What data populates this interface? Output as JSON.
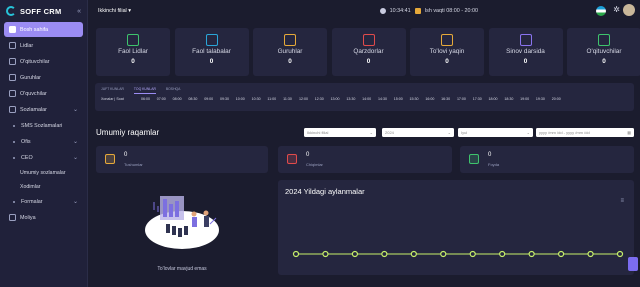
{
  "app": {
    "name": "SOFF CRM"
  },
  "sidebar": {
    "items": [
      {
        "label": "Bosh sahifa",
        "active": true
      },
      {
        "label": "Lidlar"
      },
      {
        "label": "O'qituvchilar"
      },
      {
        "label": "Guruhlar"
      },
      {
        "label": "O'quvchilar"
      },
      {
        "label": "Sozlamalar",
        "expandable": true
      },
      {
        "label": "SMS Sozlamalari",
        "bullet": true
      },
      {
        "label": "Ofis",
        "bullet": true,
        "expandable": true
      },
      {
        "label": "CEO",
        "bullet": true,
        "expandable": true
      }
    ],
    "ceo_sub": [
      "Umumiy sozlamalar",
      "Xodimlar"
    ],
    "more": [
      {
        "label": "Formalar",
        "bullet": true,
        "expandable": true
      },
      {
        "label": "Moliya"
      }
    ]
  },
  "topbar": {
    "branch": "Ikkinchi filial",
    "time": "10:34:41",
    "work_hours": "Ish vaqti 08:00 - 20:00"
  },
  "stats": [
    {
      "label": "Faol Lidlar",
      "value": "0",
      "color": "#3ec46d"
    },
    {
      "label": "Faol talabalar",
      "value": "0",
      "color": "#2aa6d8"
    },
    {
      "label": "Guruhlar",
      "value": "0",
      "color": "#e6a93a"
    },
    {
      "label": "Qarzdorlar",
      "value": "0",
      "color": "#e04b4b"
    },
    {
      "label": "To'lovi yaqin",
      "value": "0",
      "color": "#e6a93a"
    },
    {
      "label": "Sinov darsida",
      "value": "0",
      "color": "#8a74f0"
    },
    {
      "label": "O'qituvchilar",
      "value": "0",
      "color": "#3ec46d"
    }
  ],
  "schedule": {
    "tabs": [
      "JUFT KUNLAR",
      "TOQ KUNLAR",
      "BOSHQA"
    ],
    "active_tab": 1,
    "row_label": "Xonalar | Soat",
    "times": [
      "06:00",
      "07:00",
      "08:00",
      "08:30",
      "09:00",
      "09:30",
      "10:00",
      "10:30",
      "11:00",
      "11:30",
      "12:00",
      "12:30",
      "13:00",
      "13:30",
      "14:00",
      "14:30",
      "15:00",
      "15:30",
      "16:00",
      "16:30",
      "17:00",
      "17:30",
      "18:00",
      "18:30",
      "19:00",
      "19:30",
      "20:00"
    ]
  },
  "overview": {
    "title": "Umumiy raqamlar",
    "filters": [
      {
        "value": "Ikkinchi filial"
      },
      {
        "value": "2024"
      },
      {
        "value": "Iyul"
      },
      {
        "value": "yyyy /mm /dd - yyyy /mm /dd"
      }
    ],
    "cards": [
      {
        "value": "0",
        "label": "Tushumlar",
        "color": "#e6a93a"
      },
      {
        "value": "0",
        "label": "Chiqimlar",
        "color": "#e04b4b"
      },
      {
        "value": "0",
        "label": "Foyda",
        "color": "#3ec46d"
      }
    ],
    "empty_text": "To'lovlar mavjud emas"
  },
  "chart_data": {
    "type": "line",
    "title": "2024 Yildagi aylanmalar",
    "categories": [
      "",
      "",
      "",
      "",
      "",
      "",
      "",
      "",
      "",
      "",
      "",
      ""
    ],
    "series": [
      {
        "values": [
          0,
          0,
          0,
          0,
          0,
          0,
          0,
          0,
          0,
          0,
          0,
          0
        ]
      }
    ],
    "color": "#c7f06a"
  }
}
